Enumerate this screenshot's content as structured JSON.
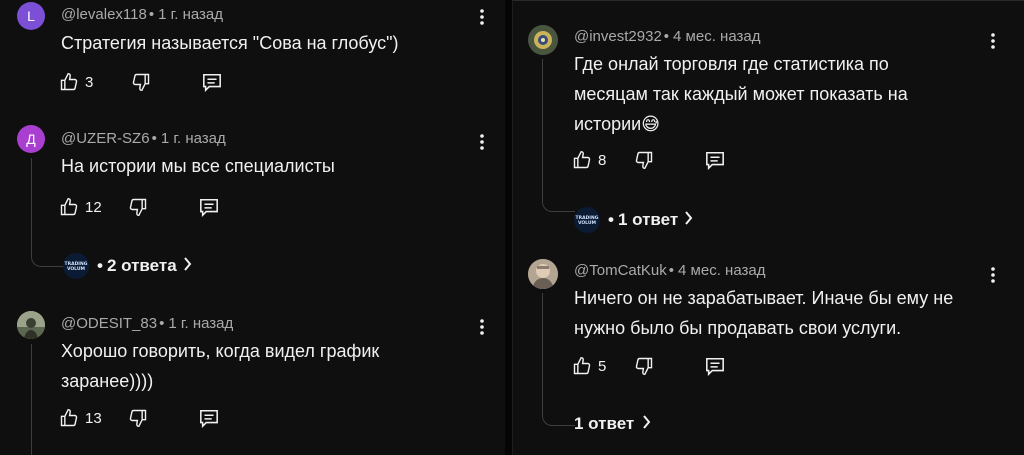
{
  "left": {
    "comments": [
      {
        "author": "@levalex118",
        "time": "1 г. назад",
        "avatar_letter": "L",
        "avatar_color": "#7b4fd6",
        "text_lines": [
          "Стратегия называется \"Сова на глобус\")"
        ],
        "likes": "3"
      },
      {
        "author": "@UZER-SZ6",
        "time": "1 г. назад",
        "avatar_letter": "Д",
        "avatar_color": "#a93fd0",
        "text_lines": [
          "На истории мы все специалисты"
        ],
        "likes": "12",
        "replies_label": "2 ответа",
        "replies_avatar_text": "TRADING VOLUM"
      },
      {
        "author": "@ODESIT_83",
        "time": "1 г. назад",
        "avatar_letter": "",
        "avatar_color": "#6b7a5e",
        "text_lines": [
          "Хорошо говорить, когда видел график",
          "заранее))))"
        ],
        "likes": "13"
      }
    ]
  },
  "right": {
    "comments": [
      {
        "author": "@invest2932",
        "time": "4 мес. назад",
        "avatar_color": "#3f4a3a",
        "text_lines": [
          "Где онлай торговля где статистика по",
          "месяцам так каждый может показать на",
          "истории😅"
        ],
        "likes": "8",
        "replies_label": "1 ответ",
        "replies_avatar_text": "TRADING VOLUM"
      },
      {
        "author": "@TomCatKuk",
        "time": "4 мес. назад",
        "avatar_color": "#8a7c6c",
        "text_lines": [
          "Ничего он не зарабатывает. Иначе бы ему не",
          "нужно было бы продавать свои услуги."
        ],
        "likes": "5",
        "replies_label": "1 ответ"
      }
    ]
  },
  "icons": {
    "like": "thumbs-up-icon",
    "dislike": "thumbs-down-icon",
    "reply": "reply-icon",
    "more": "kebab-menu-icon",
    "chevron": "chevron-right-icon"
  }
}
